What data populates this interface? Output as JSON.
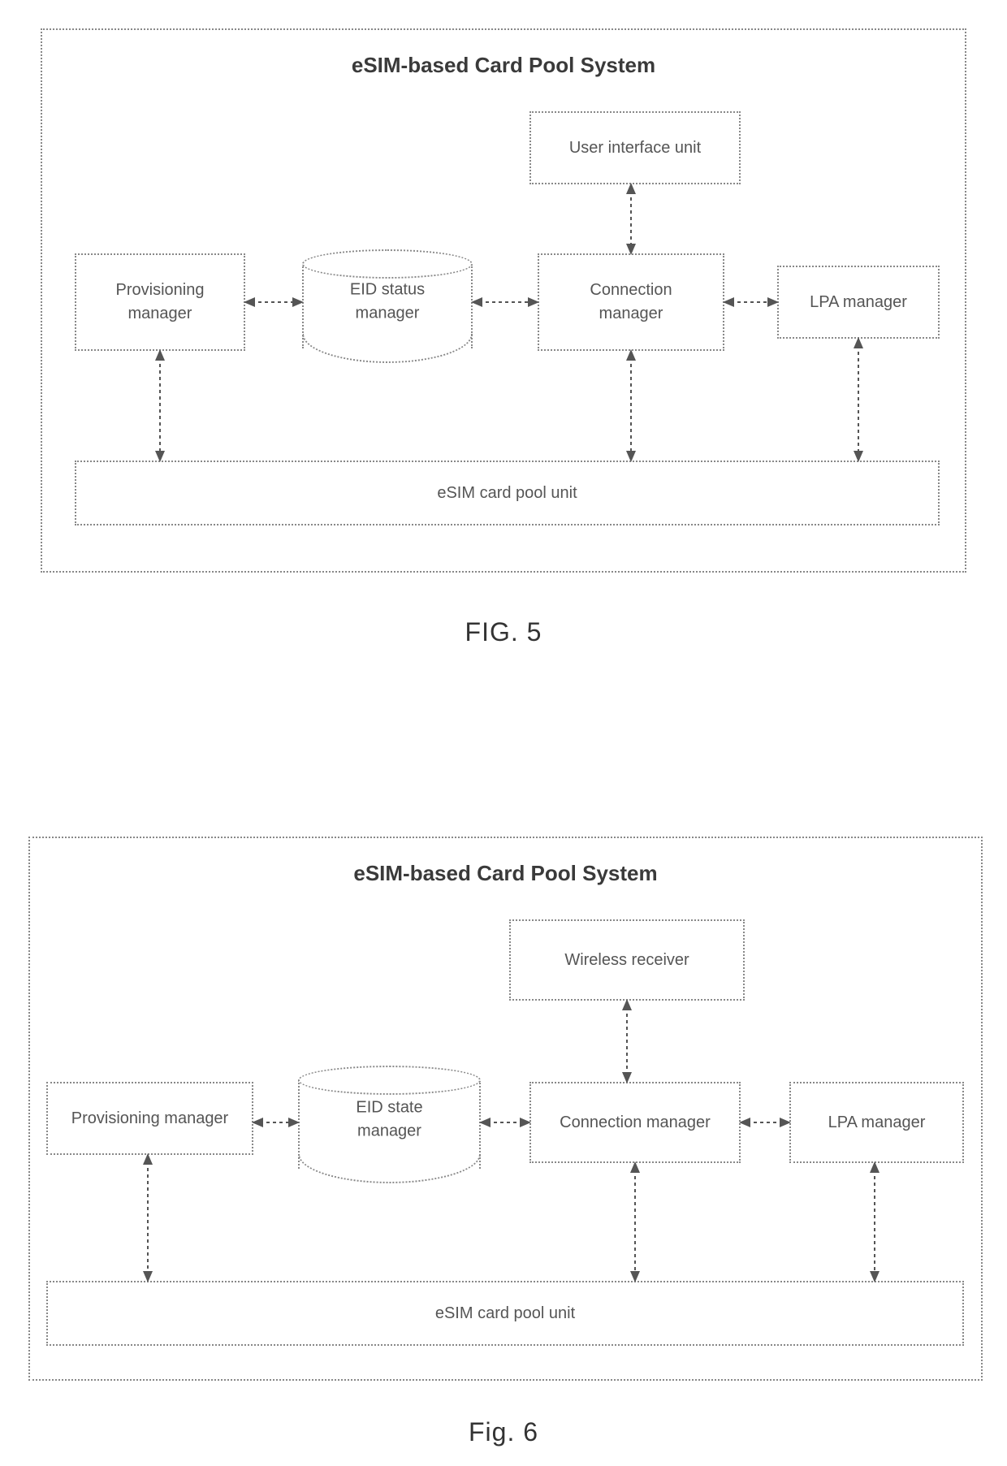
{
  "figures": {
    "fig5": {
      "caption": "FIG. 5",
      "system_title": "eSIM-based Card Pool System",
      "boxes": {
        "ui_unit": "User interface unit",
        "provisioning": "Provisioning\nmanager",
        "eid": "EID status\nmanager",
        "connection": "Connection\nmanager",
        "lpa": "LPA manager",
        "pool": "eSIM card pool unit"
      }
    },
    "fig6": {
      "caption": "Fig. 6",
      "system_title": "eSIM-based Card Pool System",
      "boxes": {
        "wireless": "Wireless receiver",
        "provisioning": "Provisioning manager",
        "eid": "EID state\nmanager",
        "connection": "Connection manager",
        "lpa": "LPA manager",
        "pool": "eSIM card pool unit"
      }
    }
  }
}
